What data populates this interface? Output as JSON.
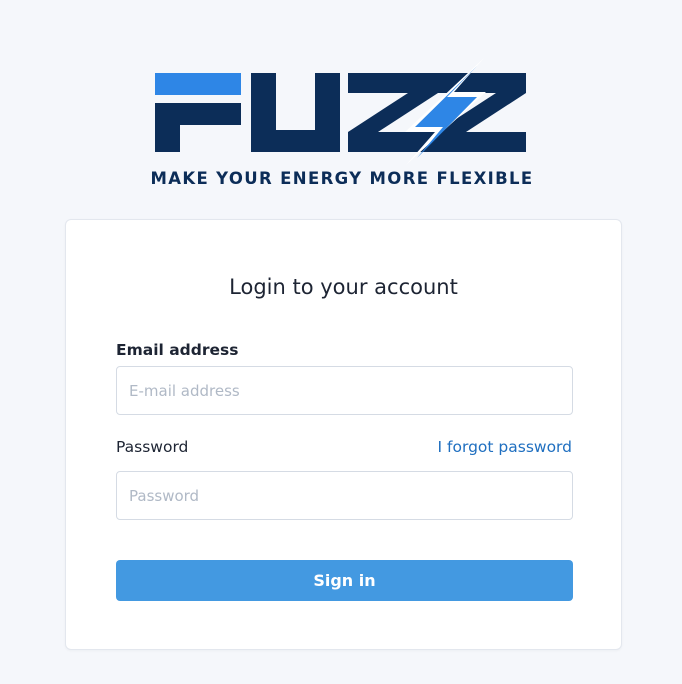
{
  "brand": {
    "logo_text": "FUZZ",
    "tagline": "MAKE YOUR ENERGY MORE FLEXIBLE",
    "colors": {
      "navy": "#0c2d58",
      "blue": "#2e86e6"
    }
  },
  "login_form": {
    "title": "Login to your account",
    "email": {
      "label": "Email address",
      "placeholder": "E-mail address",
      "value": ""
    },
    "password": {
      "label": "Password",
      "placeholder": "Password",
      "value": "",
      "forgot_link": "I forgot password"
    },
    "submit_label": "Sign in",
    "accent_color": "#4399e1",
    "link_color": "#1f6fc0"
  }
}
